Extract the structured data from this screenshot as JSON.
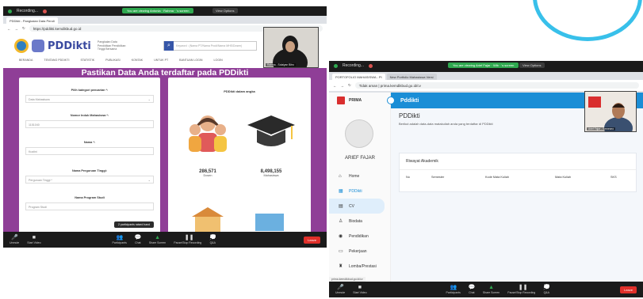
{
  "left": {
    "zoom_top": {
      "recording": "Recording...",
      "green_notice": "You are viewing Antonia · Rahma · 's screen",
      "view_options": "View Options"
    },
    "browser": {
      "tab_active": "PDDikti - Pangkalan Data Pendi",
      "url": "https://pddikti.kemdikbud.go.id"
    },
    "site": {
      "logo_text": "PDDikti",
      "logo_sub": "Pangkalan Data Pendidikan Pendidikan Tinggi Bersama",
      "search_placeholder": "Keyword : (Nama PT/Nama Prodi/Nama MHS/Dosen)",
      "nav": [
        "BERANDA",
        "TENTANG PDDIKTI",
        "STATISTIK",
        "PUBLIKASI",
        "KONTAK",
        "UNTUK PT",
        "BANTUAN LOGIN",
        "LOGIN"
      ],
      "hero_title": "Pastikan Data Anda terdaftar pada PDDikti"
    },
    "form": {
      "category_label": "Pilih kategori pencarian *:",
      "category_value": "Data Mahasiswa",
      "nim_label": "Nomor Induk Mahasiswa *:",
      "nim_value": "1151040",
      "name_label": "Nama *:",
      "name_value": "Kustini",
      "pt_label": "Nama Perguruan Tinggi:",
      "pt_value": "Perguruan Tinggi *",
      "prodi_label": "Nama Program Studi",
      "prodi_value": "Program Studi"
    },
    "stats": {
      "title": "PDDikti dalam angka",
      "dosen_num": "286,571",
      "dosen_label": "Dosen",
      "mhs_num": "8,498,155",
      "mhs_label": "Mahasiswa"
    },
    "popup": "2 participants raised hand",
    "webcam_caption": "Rahma - Solaiyan Bitro",
    "footer": {
      "unmute": "Unmute",
      "start_video": "Start Video",
      "participants": "Participants",
      "chat": "Chat",
      "share": "Share Screen",
      "pause_rec": "Pause/Stop Recording",
      "qa": "Q&A",
      "leave": "Leave"
    }
  },
  "right": {
    "zoom_top": {
      "recording": "Recording...",
      "green_notice": "You are viewing Arief Fajar · Wib · 's screen",
      "view_options": "View Options"
    },
    "browser": {
      "tab_active": "PORTOFOLIO MAHASISWA - PI",
      "tab_inactive": "New Portfolio Mahasiswa Versi",
      "url": "Tidak aman | prima.kemdikbud.go.id/cv"
    },
    "app": {
      "brand": "PRIMA",
      "top_title": "Pddikti",
      "user_name": "ARIEF FAJAR",
      "page_title": "PDDikti",
      "page_sub": "Berikut adalah data-data matakuliah anda yang terdaftar di PDDikti",
      "panel_title": "Riwayat Akademik",
      "columns": [
        "No",
        "Semester",
        "Kode Mata Kuliah",
        "Mata Kuliah",
        "SKS"
      ],
      "menu": [
        {
          "label": "Home",
          "icon": "home-icon"
        },
        {
          "label": "PDDikti",
          "icon": "db-icon"
        },
        {
          "label": "CV",
          "icon": "cv-icon"
        },
        {
          "label": "Biodata",
          "icon": "person-icon"
        },
        {
          "label": "Pendidikan",
          "icon": "education-icon"
        },
        {
          "label": "Pekerjaan",
          "icon": "work-icon"
        },
        {
          "label": "Lomba/Prestasi",
          "icon": "trophy-icon"
        }
      ],
      "status_url": "prima.kemdikbud.go.id/cv"
    },
    "webcam_caption": "Arief Fajar - Semeseo",
    "footer": {
      "unmute": "Unmute",
      "start_video": "Start Video",
      "participants": "Participants",
      "chat": "Chat",
      "share": "Share Screen",
      "pause_rec": "Pause/Stop Recording",
      "qa": "Q&A",
      "leave": "Leave"
    }
  },
  "colors": {
    "zoom_dark": "#1b1b1b",
    "pddikti_purple": "#8f3e97",
    "prima_blue": "#1b8ed6",
    "leave_red": "#e0302a",
    "arc_cyan": "#38c0ea"
  }
}
